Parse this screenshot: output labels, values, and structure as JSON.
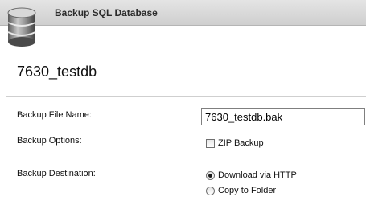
{
  "header": {
    "title": "Backup SQL Database"
  },
  "database": {
    "name": "7630_testdb",
    "icon": "database-icon"
  },
  "form": {
    "file_name_label": "Backup File Name:",
    "file_name_value": "7630_testdb.bak",
    "options_label": "Backup Options:",
    "zip_label": "ZIP Backup",
    "zip_checked": false,
    "destination_label": "Backup Destination:",
    "destinations": [
      {
        "label": "Download via HTTP",
        "selected": true
      },
      {
        "label": "Copy to Folder",
        "selected": false
      }
    ]
  }
}
